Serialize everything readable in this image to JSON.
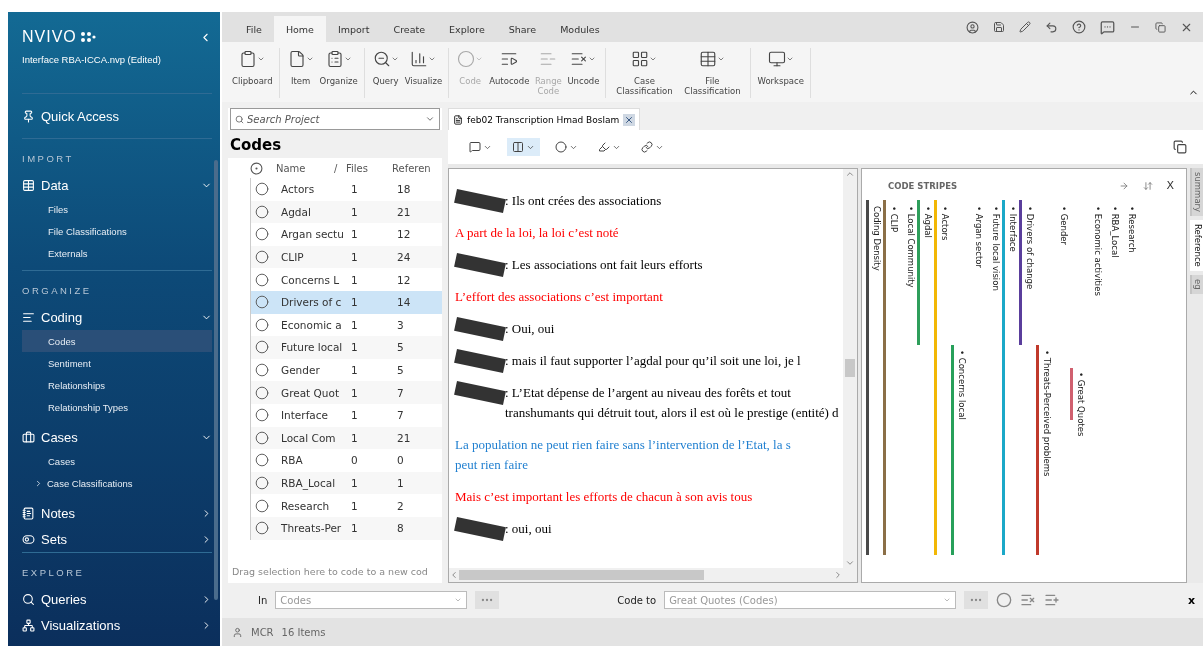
{
  "sidebar": {
    "logo": "NVIVO",
    "project": "Interface RBA-ICCA.nvp (Edited)",
    "quick_access": "Quick Access",
    "sections": [
      {
        "heading": "IMPORT",
        "items": [
          {
            "label": "Data",
            "expanded": true,
            "children": [
              {
                "label": "Files",
                "selected": false,
                "kind": "leaf"
              },
              {
                "label": "File Classifications",
                "selected": false,
                "kind": "leaf"
              },
              {
                "label": "Externals",
                "selected": false,
                "kind": "leaf"
              }
            ]
          }
        ]
      },
      {
        "heading": "ORGANIZE",
        "items": [
          {
            "label": "Coding",
            "expanded": true,
            "children": [
              {
                "label": "Codes",
                "selected": true,
                "kind": "leaf"
              },
              {
                "label": "Sentiment",
                "selected": false,
                "kind": "leaf"
              },
              {
                "label": "Relationships",
                "selected": false,
                "kind": "leaf"
              },
              {
                "label": "Relationship Types",
                "selected": false,
                "kind": "leaf"
              }
            ]
          },
          {
            "label": "Cases",
            "expanded": true,
            "children": [
              {
                "label": "Cases",
                "selected": false,
                "kind": "leaf"
              },
              {
                "label": "Case Classifications",
                "selected": false,
                "kind": "folder"
              }
            ]
          },
          {
            "label": "Notes",
            "expanded": false
          },
          {
            "label": "Sets",
            "expanded": false
          }
        ]
      },
      {
        "heading": "EXPLORE",
        "items": [
          {
            "label": "Queries",
            "expanded": false
          },
          {
            "label": "Visualizations",
            "expanded": false
          }
        ]
      }
    ]
  },
  "ribbon": {
    "tabs": [
      {
        "label": "File",
        "selected": false
      },
      {
        "label": "Home",
        "selected": true
      },
      {
        "label": "Import",
        "selected": false
      },
      {
        "label": "Create",
        "selected": false
      },
      {
        "label": "Explore",
        "selected": false
      },
      {
        "label": "Share",
        "selected": false
      },
      {
        "label": "Modules",
        "selected": false
      }
    ],
    "groups": [
      {
        "buttons": [
          {
            "label": "Clipboard",
            "disabled": false,
            "dropdown": true
          }
        ]
      },
      {
        "buttons": [
          {
            "label": "Item",
            "disabled": false,
            "dropdown": true
          },
          {
            "label": "Organize",
            "disabled": false,
            "dropdown": true
          }
        ]
      },
      {
        "buttons": [
          {
            "label": "Query",
            "disabled": false,
            "dropdown": true
          },
          {
            "label": "Visualize",
            "disabled": false,
            "dropdown": true
          }
        ]
      },
      {
        "buttons": [
          {
            "label": "Code",
            "disabled": true,
            "dropdown": true
          },
          {
            "label": "Autocode",
            "disabled": false,
            "dropdown": false
          },
          {
            "label": "Range Code",
            "disabled": true,
            "dropdown": false
          },
          {
            "label": "Uncode",
            "disabled": false,
            "dropdown": true
          }
        ]
      },
      {
        "buttons": [
          {
            "label": "Case Classification",
            "disabled": false,
            "dropdown": true
          },
          {
            "label": "File Classification",
            "disabled": false,
            "dropdown": true
          }
        ]
      },
      {
        "buttons": [
          {
            "label": "Workspace",
            "disabled": false,
            "dropdown": true
          }
        ]
      }
    ]
  },
  "codes": {
    "search_placeholder": "Search Project",
    "title": "Codes",
    "columns": [
      {
        "label": "Name",
        "sort": "/"
      },
      {
        "label": "Files"
      },
      {
        "label": "Referen"
      }
    ],
    "rows": [
      {
        "name": "Actors",
        "files": "1",
        "references": "18",
        "selected": false
      },
      {
        "name": "Agdal",
        "files": "1",
        "references": "21",
        "selected": false
      },
      {
        "name": "Argan sectu",
        "files": "1",
        "references": "12",
        "selected": false
      },
      {
        "name": "CLIP",
        "files": "1",
        "references": "24",
        "selected": false
      },
      {
        "name": "Concerns L",
        "files": "1",
        "references": "12",
        "selected": false
      },
      {
        "name": "Drivers of c",
        "files": "1",
        "references": "14",
        "selected": true
      },
      {
        "name": "Economic a",
        "files": "1",
        "references": "3",
        "selected": false
      },
      {
        "name": "Future local",
        "files": "1",
        "references": "5",
        "selected": false
      },
      {
        "name": "Gender",
        "files": "1",
        "references": "5",
        "selected": false
      },
      {
        "name": "Great Quot",
        "files": "1",
        "references": "7",
        "selected": false
      },
      {
        "name": "Interface",
        "files": "1",
        "references": "7",
        "selected": false
      },
      {
        "name": "Local Com",
        "files": "1",
        "references": "21",
        "selected": false
      },
      {
        "name": "RBA",
        "files": "0",
        "references": "0",
        "selected": false
      },
      {
        "name": "RBA_Local",
        "files": "1",
        "references": "1",
        "selected": false
      },
      {
        "name": "Research",
        "files": "1",
        "references": "2",
        "selected": false
      },
      {
        "name": "Threats-Per",
        "files": "1",
        "references": "8",
        "selected": false
      }
    ],
    "footer": "Drag selection here to code to a new cod"
  },
  "document": {
    "tab_title": "feb02 Transcription Hmad Boslam",
    "paragraphs": [
      {
        "redacted": true,
        "color": "#000000",
        "lines": [
          ": Ils ont crées des associations"
        ]
      },
      {
        "redacted": false,
        "color": "#ff0000",
        "lines": [
          "A part de la loi, la loi c’est noté"
        ]
      },
      {
        "redacted": true,
        "color": "#000000",
        "lines": [
          ": Les associations ont fait leurs efforts"
        ]
      },
      {
        "redacted": false,
        "color": "#ff0000",
        "lines": [
          "L’effort des associations c’est important"
        ]
      },
      {
        "redacted": true,
        "color": "#000000",
        "lines": [
          ": Oui, oui"
        ]
      },
      {
        "redacted": true,
        "color": "#000000",
        "lines": [
          ": mais il faut supporter l’agdal pour qu’il soit une loi, je l"
        ]
      },
      {
        "redacted": true,
        "color": "#000000",
        "lines": [
          ": L’Etat dépense de l’argent au niveau des forêts et tout",
          "transhumants qui détruit tout, alors il est où le prestige (entité)  d"
        ]
      },
      {
        "redacted": false,
        "color": "#1f7fd0",
        "lines": [
          "La population ne peut rien faire sans l’intervention de l’Etat, la s",
          "peut rien faire"
        ]
      },
      {
        "redacted": false,
        "color": "#ff0000",
        "lines": [
          "Mais c’est important les efforts de chacun à son avis tous"
        ]
      },
      {
        "redacted": true,
        "color": "#000000",
        "lines": [
          ": oui, oui"
        ]
      }
    ]
  },
  "stripes": {
    "title": "CODE STRIPES",
    "close": "X",
    "items": [
      {
        "label": "Coding Density",
        "kind": "full",
        "color": "#4a4a4a"
      },
      {
        "label": "• CLIP",
        "kind": "full",
        "color": "#8b6f47"
      },
      {
        "label": "• Local Community",
        "kind": "none"
      },
      {
        "label": "• Agdal",
        "kind": "upper",
        "color": "#2e9e5b"
      },
      {
        "label": "• Actors",
        "kind": "full",
        "color": "#f2b705"
      },
      {
        "label": "• Concerns local",
        "kind": "lower",
        "color": "#27a05a"
      },
      {
        "label": "• Argan sector",
        "kind": "none"
      },
      {
        "label": "• Future local vision",
        "kind": "none"
      },
      {
        "label": "• Interface",
        "kind": "full",
        "color": "#1ba8c8"
      },
      {
        "label": "• Drivers of change",
        "kind": "upper",
        "color": "#5a3e9c"
      },
      {
        "label": "• Threats-Perceived problems",
        "kind": "lower",
        "color": "#c0392b"
      },
      {
        "label": "• Gender",
        "kind": "none"
      },
      {
        "label": "• Great Quotes",
        "kind": "middle",
        "color": "#d0606f"
      },
      {
        "label": "• Economic activities",
        "kind": "none"
      },
      {
        "label": "• RBA_Local",
        "kind": "none"
      },
      {
        "label": "• Research",
        "kind": "none"
      }
    ]
  },
  "side_tabs": [
    {
      "label": "summary",
      "selected": false
    },
    {
      "label": "Reference",
      "selected": true
    },
    {
      "label": "eg",
      "selected": false
    }
  ],
  "bottom_bar": {
    "in_label": "In",
    "in_value": "Codes",
    "code_to_label": "Code to",
    "code_to_value": "Great Quotes (Codes)",
    "close": "x"
  },
  "status_bar": {
    "user": "MCR",
    "items": "16 Items"
  }
}
